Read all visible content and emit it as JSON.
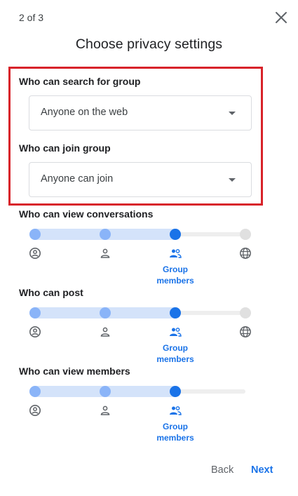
{
  "dialog": {
    "step": "2 of 3",
    "title": "Choose privacy settings",
    "close_icon": "close-icon"
  },
  "search_setting": {
    "label": "Who can search for group",
    "value": "Anyone on the web"
  },
  "join_setting": {
    "label": "Who can join group",
    "value": "Anyone can join"
  },
  "sliders": [
    {
      "label": "Who can view conversations",
      "options": [
        "owners-icon",
        "person-icon",
        "group-icon",
        "globe-icon"
      ],
      "selected_index": 2,
      "selected_caption": [
        "Group",
        "members"
      ]
    },
    {
      "label": "Who can post",
      "options": [
        "owners-icon",
        "person-icon",
        "group-icon",
        "globe-icon"
      ],
      "selected_index": 2,
      "selected_caption": [
        "Group",
        "members"
      ]
    },
    {
      "label": "Who can view members",
      "options": [
        "owners-icon",
        "person-icon",
        "group-icon"
      ],
      "selected_index": 2,
      "selected_caption": [
        "Group",
        "members"
      ]
    }
  ],
  "footer": {
    "back": "Back",
    "next": "Next"
  },
  "colors": {
    "accent": "#1a73e8",
    "highlight_border": "#d8232a",
    "inactive_dot": "#8ab4f8",
    "track_fill": "#d4e3fa"
  }
}
